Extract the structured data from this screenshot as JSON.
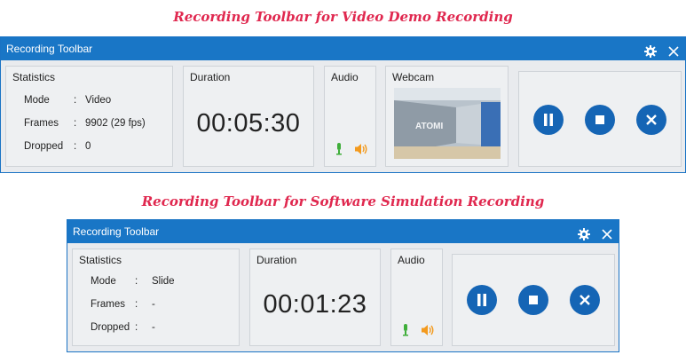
{
  "captions": {
    "video": "Recording Toolbar for Video Demo Recording",
    "simulation": "Recording Toolbar for Software Simulation Recording"
  },
  "video_toolbar": {
    "title": "Recording Toolbar",
    "statistics": {
      "heading": "Statistics",
      "rows": [
        {
          "label": "Mode",
          "sep": ":",
          "value": "Video"
        },
        {
          "label": "Frames",
          "sep": ":",
          "value": "9902 (29 fps)"
        },
        {
          "label": "Dropped",
          "sep": ":",
          "value": "0"
        }
      ]
    },
    "duration": {
      "heading": "Duration",
      "value": "00:05:30"
    },
    "audio": {
      "heading": "Audio"
    },
    "webcam": {
      "heading": "Webcam",
      "sign_text": "ATOMI"
    }
  },
  "simulation_toolbar": {
    "title": "Recording Toolbar",
    "statistics": {
      "heading": "Statistics",
      "rows": [
        {
          "label": "Mode",
          "sep": ":",
          "value": "Slide"
        },
        {
          "label": "Frames",
          "sep": ":",
          "value": "-"
        },
        {
          "label": "Dropped",
          "sep": ":",
          "value": "-"
        }
      ]
    },
    "duration": {
      "heading": "Duration",
      "value": "00:01:23"
    },
    "audio": {
      "heading": "Audio"
    }
  },
  "icons": {
    "settings": "gear-icon",
    "close": "close-icon",
    "pause": "pause-icon",
    "stop": "stop-icon",
    "cancel": "cancel-icon",
    "microphone": "microphone-icon",
    "speaker": "speaker-icon"
  },
  "colors": {
    "caption": "#e0284f",
    "titlebar": "#1976c6",
    "control_button": "#1565b5",
    "mic": "#3fae3a",
    "speaker": "#f39a1e"
  }
}
